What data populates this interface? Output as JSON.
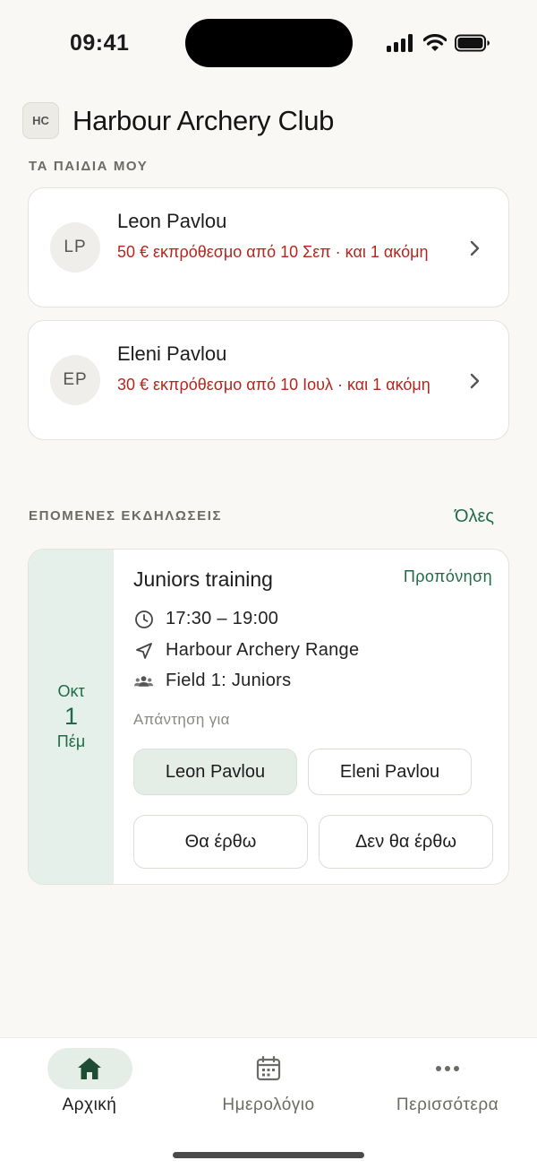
{
  "status_bar": {
    "time": "09:41"
  },
  "header": {
    "logo_initials": "HC",
    "title": "Harbour Archery Club"
  },
  "children_section": {
    "label": "ΤΑ ΠΑΙΔΙΑ ΜΟΥ",
    "items": [
      {
        "initials": "LP",
        "name": "Leon Pavlou",
        "due_text": "50 € εκπρόθεσμο από 10 Σεπ · και 1 ακόμη"
      },
      {
        "initials": "EP",
        "name": "Eleni Pavlou",
        "due_text": "30 € εκπρόθεσμο από 10 Ιουλ · και 1 ακόμη"
      }
    ]
  },
  "events_section": {
    "label": "ΕΠΟΜΕΝΕΣ ΕΚΔΗΛΩΣΕΙΣ",
    "all_link": "Όλες",
    "event": {
      "month": "Οκτ",
      "day": "1",
      "weekday": "Πέμ",
      "title": "Juniors training",
      "type": "Προπόνηση",
      "time": "17:30 – 19:00",
      "location": "Harbour Archery Range",
      "group": "Field 1: Juniors",
      "answer_for_label": "Απάντηση για",
      "children": [
        "Leon Pavlou",
        "Eleni Pavlou"
      ],
      "selected_child": "Leon Pavlou",
      "rsvp_yes": "Θα έρθω",
      "rsvp_no": "Δεν θα έρθω"
    }
  },
  "tab_bar": {
    "tabs": [
      {
        "label": "Αρχική",
        "icon": "home-icon",
        "active": true
      },
      {
        "label": "Ημερολόγιο",
        "icon": "calendar-icon",
        "active": false
      },
      {
        "label": "Περισσότερα",
        "icon": "more-icon",
        "active": false
      }
    ]
  },
  "colors": {
    "accent": "#1f6b46",
    "overdue": "#b3261e",
    "background": "#f9f8f5"
  }
}
